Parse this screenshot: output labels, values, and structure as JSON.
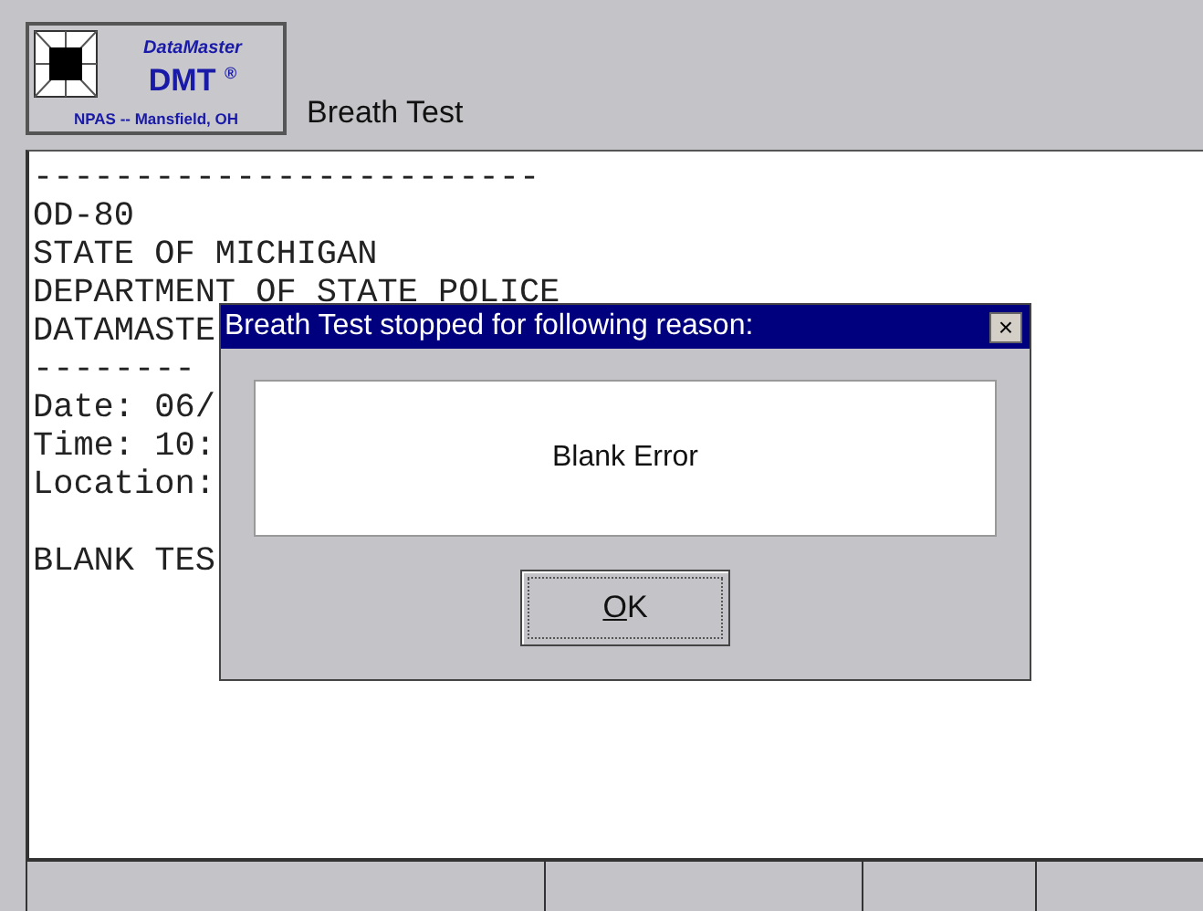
{
  "header": {
    "logo": {
      "line_1": "DataMaster",
      "line_2": "DMT",
      "mark": "®",
      "line_3": "NPAS -- Mansfield, OH"
    },
    "title": "Breath Test"
  },
  "report_lines": [
    {
      "text": "-------------------------",
      "space_before": false
    },
    {
      "text": "OD-80",
      "space_before": false
    },
    {
      "text": "STATE OF MICHIGAN",
      "space_before": false
    },
    {
      "text": "DEPARTMENT OF STATE POLICE",
      "space_before": false
    },
    {
      "text": "DATAMASTE",
      "space_before": false
    },
    {
      "text": "--------",
      "space_before": false
    },
    {
      "text": "Date: 06/",
      "space_before": false
    },
    {
      "text": "Time: 10:",
      "space_before": false
    },
    {
      "text": "Location:",
      "space_before": false
    },
    {
      "text": "BLANK TES",
      "space_before": true
    }
  ],
  "dialog": {
    "title": "Breath Test stopped for following reason:",
    "close": "×",
    "message": "Blank Error",
    "button": {
      "label": "OK"
    }
  }
}
